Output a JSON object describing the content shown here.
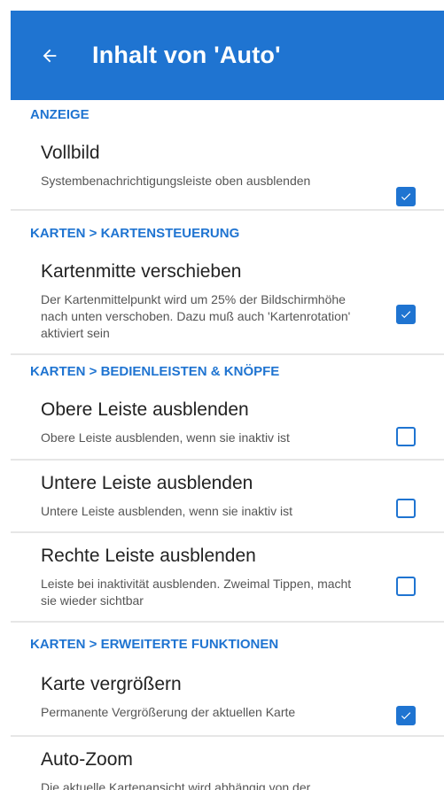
{
  "header": {
    "title": "Inhalt von 'Auto'"
  },
  "colors": {
    "accent": "#1f74d1"
  },
  "icons": {
    "back": "arrow-left-icon",
    "check": "check-icon"
  },
  "sections": [
    {
      "header": "ANZEIGE",
      "items": [
        {
          "title": "Vollbild",
          "subtitle": "Systembenachrichtigungsleiste oben ausblenden",
          "checked": true
        }
      ]
    },
    {
      "header": "KARTEN > KARTENSTEUERUNG",
      "items": [
        {
          "title": "Kartenmitte verschieben",
          "subtitle": "Der Kartenmittelpunkt wird um 25% der Bildschirmhöhe nach unten verschoben. Dazu muß auch 'Kartenrotation' aktiviert sein",
          "checked": true
        }
      ]
    },
    {
      "header": "KARTEN > BEDIENLEISTEN & KNÖPFE",
      "items": [
        {
          "title": "Obere Leiste ausblenden",
          "subtitle": "Obere Leiste ausblenden, wenn sie inaktiv ist",
          "checked": false
        },
        {
          "title": "Untere Leiste ausblenden",
          "subtitle": "Untere Leiste ausblenden, wenn sie inaktiv ist",
          "checked": false
        },
        {
          "title": "Rechte Leiste ausblenden",
          "subtitle": "Leiste bei inaktivität ausblenden. Zweimal Tippen, macht sie wieder sichtbar",
          "checked": false
        }
      ]
    },
    {
      "header": "KARTEN > ERWEITERTE FUNKTIONEN",
      "items": [
        {
          "title": "Karte vergrößern",
          "subtitle": "Permanente Vergrößerung der aktuellen Karte",
          "checked": true
        },
        {
          "title": "Auto-Zoom",
          "subtitle": "Die aktuelle Kartenansicht wird abhängig von der",
          "checked": true
        }
      ]
    }
  ]
}
